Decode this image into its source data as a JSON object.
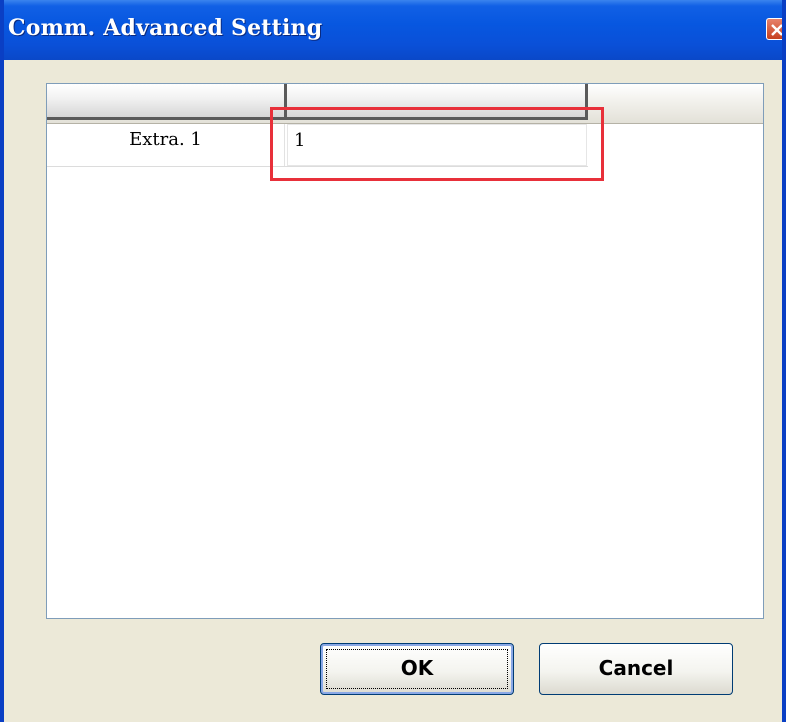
{
  "window": {
    "title": "Comm. Advanced Setting"
  },
  "grid": {
    "columns": [
      "",
      ""
    ],
    "rows": [
      {
        "label": "Extra. 1",
        "value": "1"
      }
    ]
  },
  "buttons": {
    "ok_label": "OK",
    "cancel_label": "Cancel"
  },
  "colors": {
    "titlebar": "#0757e0",
    "highlight": "#e8303a",
    "dialog_bg": "#ece9d8"
  },
  "icons": {
    "close": "close-icon"
  }
}
